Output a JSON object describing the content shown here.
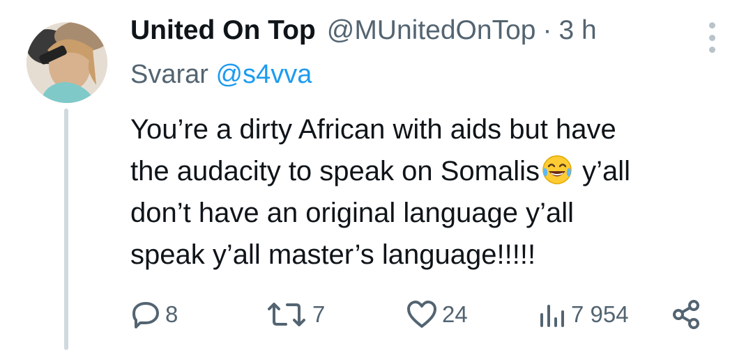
{
  "tweet": {
    "author": {
      "display_name": "United On Top",
      "handle": "@MUnitedOnTop",
      "avatar_icon": "profile-photo"
    },
    "separator": "·",
    "timestamp": "3 h",
    "reply_prefix": "Svarar",
    "reply_to": "@s4vva",
    "text_part1": "You’re a dirty African with aids but have\nthe audacity to speak on Somalis",
    "emoji_icon": "face-with-tears-of-joy-emoji",
    "text_part2": " y’all\ndon’t have an original language y’all\nspeak y’all master’s language!!!!!",
    "stats": {
      "replies": "8",
      "retweets": "7",
      "likes": "24",
      "views": "7 954"
    },
    "icons": {
      "reply": "speech-bubble-icon",
      "retweet": "retweet-arrows-icon",
      "like": "heart-icon",
      "views": "bar-chart-icon",
      "share": "share-nodes-icon",
      "more": "vertical-dots-icon"
    },
    "colors": {
      "text": "#0f1419",
      "secondary": "#536471",
      "link": "#1d9bf0",
      "thread_line": "#cfd9de"
    }
  }
}
